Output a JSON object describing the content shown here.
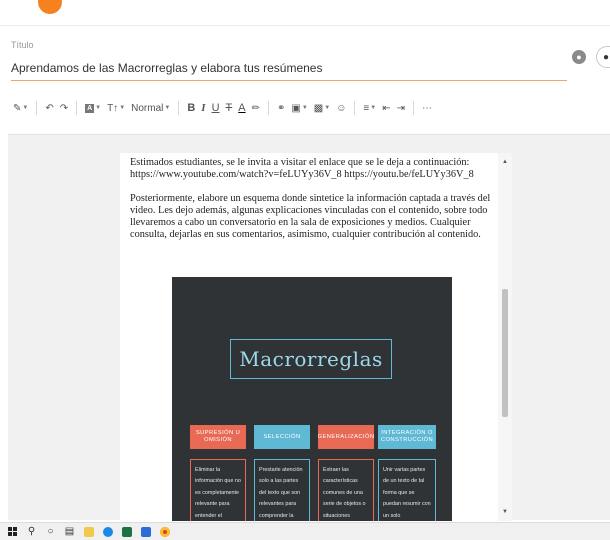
{
  "title": {
    "label": "Título",
    "value": "Aprendamos de las Macrorreglas y elabora tus resúmenes"
  },
  "toolbar": {
    "paragraph_style": "Normal",
    "buttons": [
      "pen",
      "undo",
      "redo",
      "text-background",
      "text-size",
      "bold",
      "italic",
      "underline",
      "strikethrough",
      "font-color",
      "highlight",
      "link",
      "image",
      "video",
      "emoji",
      "align",
      "indent-decrease",
      "indent-increase",
      "more"
    ]
  },
  "document": {
    "paragraph1_line1": "Estimados estudiantes, se le invita a visitar el enlace que se le deja a continuación:",
    "paragraph1_line2": "https://www.youtube.com/watch?v=feLUYy36V_8 https://youtu.be/feLUYy36V_8",
    "paragraph2": "Posteriormente, elabore un esquema donde sintetice la información captada a través del video. Les dejo además, algunas explicaciones vinculadas con el contenido, sobre todo llevaremos a cabo un conversatorio en la sala de exposiciones y medios. Cualquier consulta, dejarlas en sus comentarios, asimismo, cualquier contribución al contenido."
  },
  "infographic": {
    "title": "Macrorreglas",
    "columns": [
      {
        "heading": "SUPRESIÓN U OMISIÓN",
        "text": "Eliminar la información que no es completamente relevante para entender el",
        "color": "#e86a55"
      },
      {
        "heading": "SELECCIÓN",
        "text": "Prestarle atención solo a las partes del texto que son relevantes para comprender la",
        "color": "#5fb8d4"
      },
      {
        "heading": "GENERALIZACIÓN",
        "text": "Extraer las características comunes de una serie de objetos o situaciones",
        "color": "#e86a55"
      },
      {
        "heading": "INTEGRACIÓN O CONSTRUCCIÓN",
        "text": "Unir varias partes de un texto de tal forma que se puedan resumir con un solo",
        "color": "#5fb8d4"
      }
    ]
  },
  "colors": {
    "accent": "#f5821f",
    "title_underline": "#f3a36c",
    "infographic_bg": "#2f3336",
    "coral": "#e86a55",
    "teal": "#5fb8d4"
  },
  "taskbar": {
    "icons": [
      "windows-start",
      "search",
      "cortana",
      "task-view",
      "file-explorer",
      "edge",
      "excel",
      "mail",
      "chrome"
    ]
  }
}
